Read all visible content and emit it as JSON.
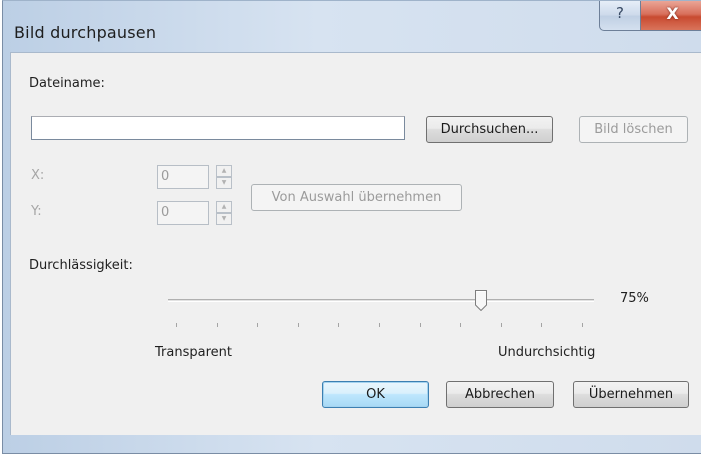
{
  "window": {
    "title": "Bild durchpausen",
    "help_glyph": "?",
    "close_glyph": "X"
  },
  "filename": {
    "label": "Dateiname:",
    "value": "",
    "browse_label": "Durchsuchen...",
    "delete_label": "Bild löschen"
  },
  "position": {
    "x_label": "X:",
    "x_value": "0",
    "y_label": "Y:",
    "y_value": "0",
    "from_selection_label": "Von Auswahl übernehmen"
  },
  "opacity": {
    "label": "Durchlässigkeit:",
    "value_percent": 75,
    "value_text": "75%",
    "min_label": "Transparent",
    "max_label": "Undurchsichtig",
    "tick_count": 11
  },
  "footer": {
    "ok_label": "OK",
    "cancel_label": "Abbrechen",
    "apply_label": "Übernehmen"
  },
  "colors": {
    "default_button_border": "#3c7fb1",
    "close_button": "#c84a30",
    "dialog_background": "#f0f0f0"
  },
  "icons": {
    "help": "question-mark-icon",
    "close": "close-icon",
    "spin_up": "chevron-up-icon",
    "spin_down": "chevron-down-icon"
  }
}
